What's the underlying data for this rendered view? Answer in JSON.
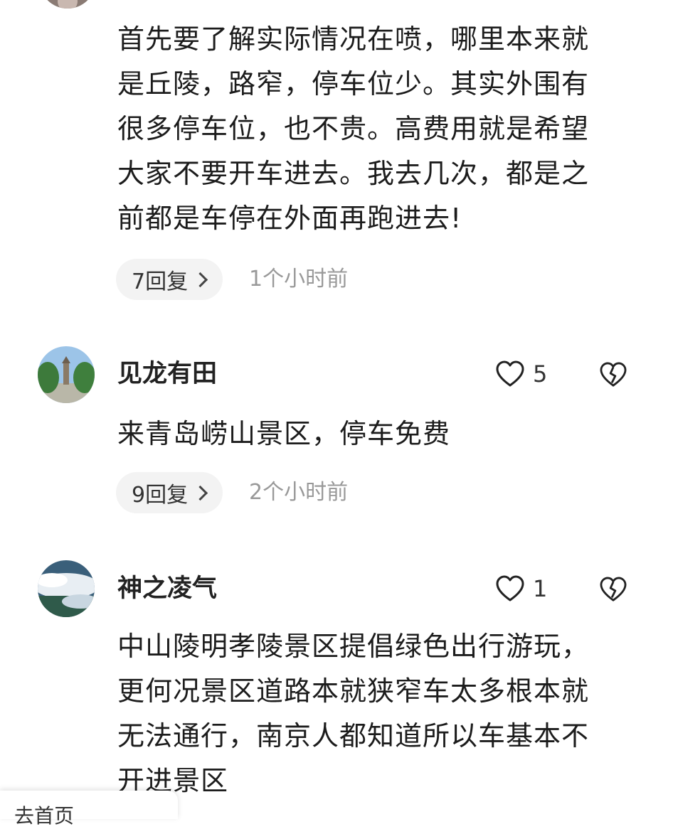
{
  "comments": [
    {
      "text": "首先要了解实际情况在喷，哪里本来就是丘陵，路窄，停车位少。其实外围有很多停车位，也不贵。高费用就是希望大家不要开车进去。我去几次，都是之前都是车停在外面再跑进去!",
      "lines": [
        "首先要了解实际情况在喷，哪里本来就",
        "是丘陵，路窄，停车位少。其实外围有",
        "很多停车位，也不贵。高费用就是希望",
        "大家不要开车进去。我去几次，都是之",
        "前都是车停在外面再跑进去!"
      ],
      "reply_label": "7回复",
      "time": "1个小时前"
    },
    {
      "user": "见龙有田",
      "likes": "5",
      "lines": [
        "来青岛崂山景区，停车免费"
      ],
      "reply_label": "9回复",
      "time": "2个小时前"
    },
    {
      "user": "神之凌气",
      "likes": "1",
      "lines": [
        "中山陵明孝陵景区提倡绿色出行游玩，",
        "更何况景区道路本就狭窄车太多根本就",
        "无法通行，南京人都知道所以车基本不",
        "开进景区"
      ]
    }
  ],
  "bottom_bar_text": "去首页",
  "icons": {
    "like": "heart-outline-icon",
    "dislike": "broken-heart-icon",
    "chevron": "chevron-right-icon"
  },
  "colors": {
    "pill_bg": "#f3f3f3",
    "time": "#999999",
    "text": "#1c1c1c"
  }
}
